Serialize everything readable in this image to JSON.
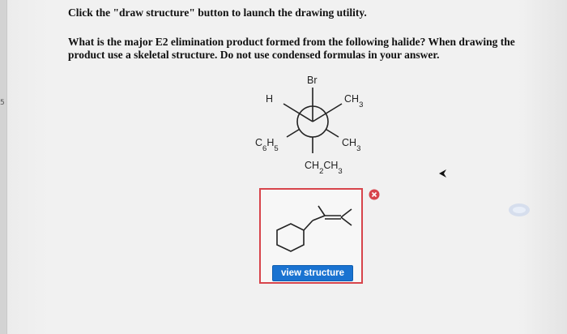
{
  "instruction": "Click the \"draw structure\" button to launch the drawing utility.",
  "question": "What is the major E2 elimination product formed from the following halide? When drawing the product use a skeletal structure. Do not use condensed formulas in your answer.",
  "edge_mark": "5",
  "newman": {
    "front_top": "Br",
    "front_left": "H",
    "front_right": "CH3",
    "back_left": "C6H5",
    "back_right": "CH3",
    "back_bottom": "CH2CH3"
  },
  "answer": {
    "view_button_label": "view structure",
    "status": "incorrect",
    "status_color": "#d7444b",
    "button_color": "#1a73d1"
  },
  "icons": {
    "incorrect": "x-circle-icon",
    "cursor": "arrow-cursor-icon"
  }
}
